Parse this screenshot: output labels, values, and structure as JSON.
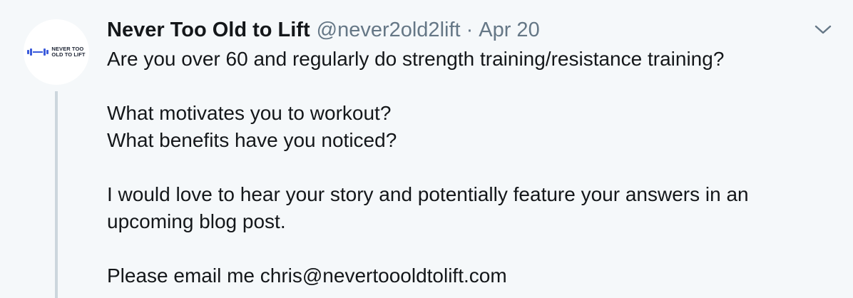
{
  "tweet": {
    "avatar": {
      "logo_line1": "NEVER TOO",
      "logo_line2": "OLD TO LIFT",
      "logo_color": "#3b5bdb"
    },
    "author_name": "Never Too Old to Lift",
    "handle": "@never2old2lift",
    "separator": "·",
    "date": "Apr 20",
    "menu_icon": "chevron-down-icon",
    "body": {
      "line1": "Are you over 60 and regularly do strength training/resistance training?",
      "line2": "What motivates you to workout?",
      "line3": "What benefits have you noticed?",
      "line4": "I would love to hear your story and potentially feature your answers in an",
      "line5": "upcoming blog post.",
      "line6_prefix": "Please email me ",
      "email": "chris@nevertoooldtolift.com"
    }
  },
  "colors": {
    "background": "#f5f8fa",
    "text": "#14171a",
    "secondary": "#657786",
    "thread_line": "#ccd6dd"
  }
}
